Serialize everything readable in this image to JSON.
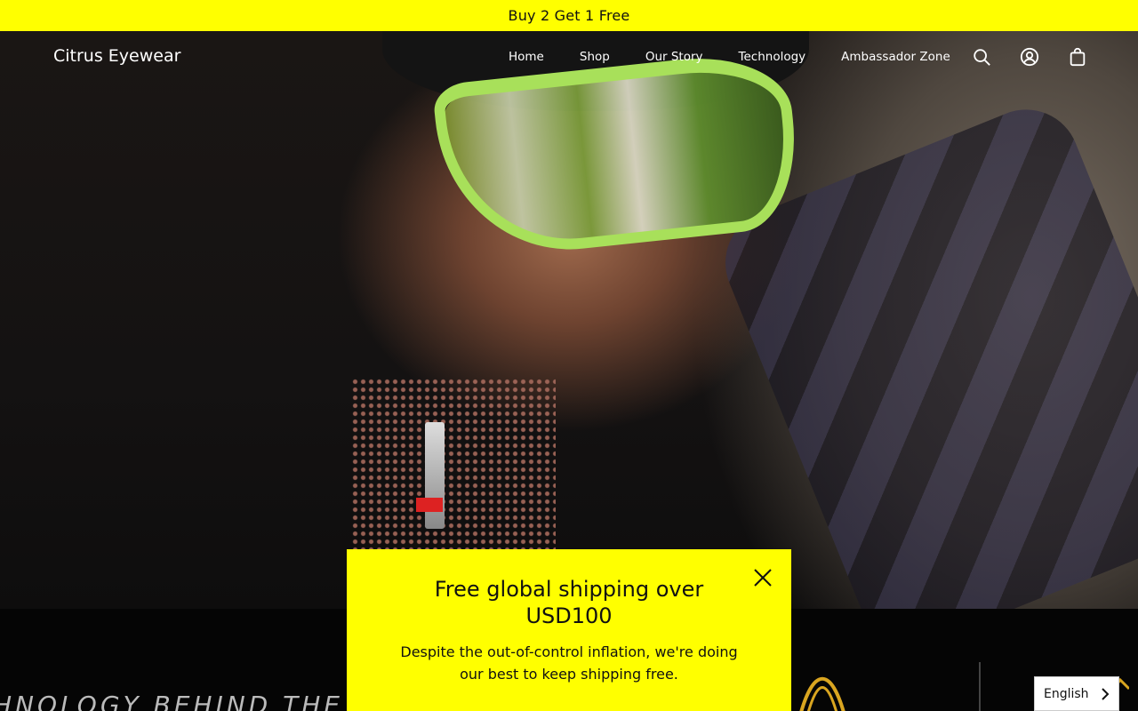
{
  "announcement": {
    "text": "Buy 2 Get 1 Free"
  },
  "header": {
    "logo": "Citrus Eyewear",
    "nav": [
      "Home",
      "Shop",
      "Our Story",
      "Technology",
      "Ambassador Zone"
    ],
    "icons": [
      "search-icon",
      "account-icon",
      "cart-icon"
    ]
  },
  "hero": {
    "image": "cyclist wearing green wraparound sunglasses and helmet"
  },
  "lower": {
    "heading": "HNOLOGY BEHIND THE"
  },
  "popup": {
    "title": "Free global shipping over USD100",
    "body": "Despite the out-of-control inflation, we're doing our best to keep shipping free.",
    "close_icon": "close-icon"
  },
  "language": {
    "selected": "English"
  },
  "colors": {
    "accent": "#FFFF00",
    "text_dark": "#111111",
    "header_text": "#FFFFFF"
  }
}
